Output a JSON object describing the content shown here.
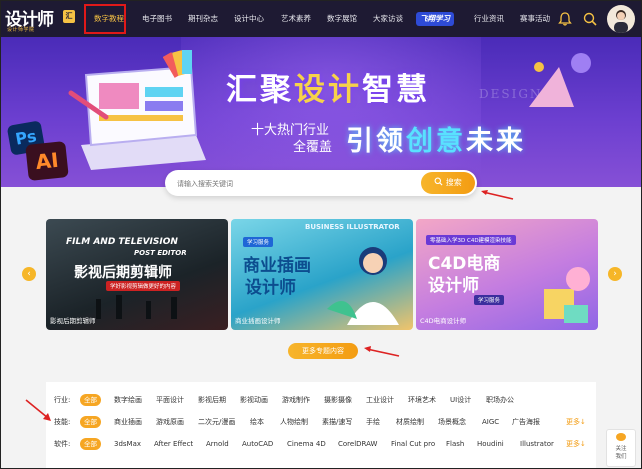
{
  "logo": {
    "text": "设计师",
    "tagline": "设计师学院",
    "badge": "汇"
  },
  "nav": {
    "items": [
      "数字教程",
      "电子图书",
      "期刊杂志",
      "设计中心",
      "艺术素养",
      "数字展馆",
      "大家访谈",
      "飞翔学习",
      "行业资讯",
      "赛事活动"
    ],
    "active_index": 0
  },
  "hero": {
    "title_a": "汇聚",
    "title_b": "设计",
    "title_c": "智慧",
    "sub1": "十大热门行业",
    "sub2": "全覆盖",
    "slogan_a": "引领",
    "slogan_b": "创意",
    "slogan_c": "未来",
    "design_word": "DESIGN",
    "ps_label": "Ps",
    "ai_label": "AI"
  },
  "search": {
    "placeholder": "请输入搜索关键词",
    "button": "搜索"
  },
  "carousel": {
    "cards": [
      {
        "title": "影视后期剪辑师",
        "caption": "影视后期剪辑师",
        "overlay": "FILM AND TELEVISION",
        "overlay2": "POST EDITOR",
        "tag": "学好影视剪辑做更好的内容"
      },
      {
        "title_a": "商业插画",
        "title_b": "设计师",
        "caption": "商业插画设计师",
        "overlay": "BUSINESS ILLUSTRATOR",
        "tag": "学习服务"
      },
      {
        "title_a": "C4D电商",
        "title_b": "设计师",
        "caption": "C4D电商设计师",
        "tag": "零基础入学3D C4D建模渲染技能",
        "tag2": "学习服务"
      }
    ],
    "prev": "‹",
    "next": "›"
  },
  "more_topics": "更多专题内容",
  "filters": {
    "rows": [
      {
        "label": "行业:",
        "all": "全部",
        "options": [
          "数字绘画",
          "平面设计",
          "影视后期",
          "影视动画",
          "游戏制作",
          "摄影摄像",
          "工业设计",
          "环境艺术",
          "UI设计",
          "职场办公"
        ],
        "more": ""
      },
      {
        "label": "技能:",
        "all": "全部",
        "options": [
          "商业插画",
          "游戏原画",
          "二次元/漫画",
          "绘本",
          "人物绘制",
          "素描/速写",
          "手绘",
          "材质绘制",
          "场景概念",
          "AIGC",
          "广告海报"
        ],
        "more": "更多↓"
      },
      {
        "label": "软件:",
        "all": "全部",
        "options": [
          "3dsMax",
          "After Effect",
          "Arnold",
          "AutoCAD",
          "Cinema 4D",
          "CorelDRAW",
          "Final Cut pro",
          "Flash",
          "Houdini",
          "Illustrator"
        ],
        "more": "更多↓"
      }
    ]
  },
  "side_float": {
    "line1": "关注",
    "line2": "我们"
  },
  "colors": {
    "accent": "#f6a623",
    "nav_bg": "#1e1a33",
    "highlight": "#e01919"
  }
}
